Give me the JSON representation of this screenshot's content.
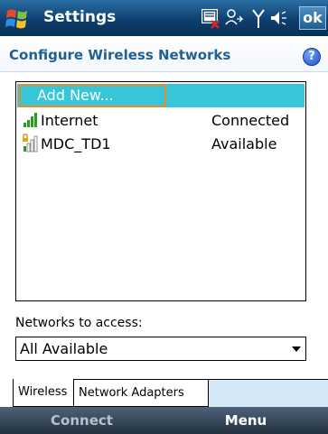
{
  "titlebar": {
    "title": "Settings",
    "ok_label": "ok",
    "icons": [
      "start-flag-icon",
      "pager-icon",
      "connectivity-icon",
      "signal-antenna-icon",
      "volume-icon"
    ]
  },
  "header": {
    "title": "Configure Wireless Networks",
    "help_glyph": "?"
  },
  "networks": {
    "add_new_label": "Add New...",
    "items": [
      {
        "name": "Internet",
        "status": "Connected",
        "icon": "signal-strength-full-icon"
      },
      {
        "name": "MDC_TD1",
        "status": "Available",
        "icon": "signal-strength-low-lock-icon"
      }
    ]
  },
  "access": {
    "label": "Networks to access:",
    "selected": "All Available"
  },
  "tabs": [
    {
      "label": "Wireless",
      "active": true
    },
    {
      "label": "Network Adapters",
      "active": false
    }
  ],
  "softkeys": {
    "left": "Connect",
    "right": "Menu"
  },
  "colors": {
    "title_bar": "#0d3f6e",
    "header_text": "#1f5f97",
    "selection": "#37c6d8",
    "focus": "#ec8a2b",
    "signal_green": "#2a9a22",
    "tab_fill": "#d4e8f7"
  }
}
